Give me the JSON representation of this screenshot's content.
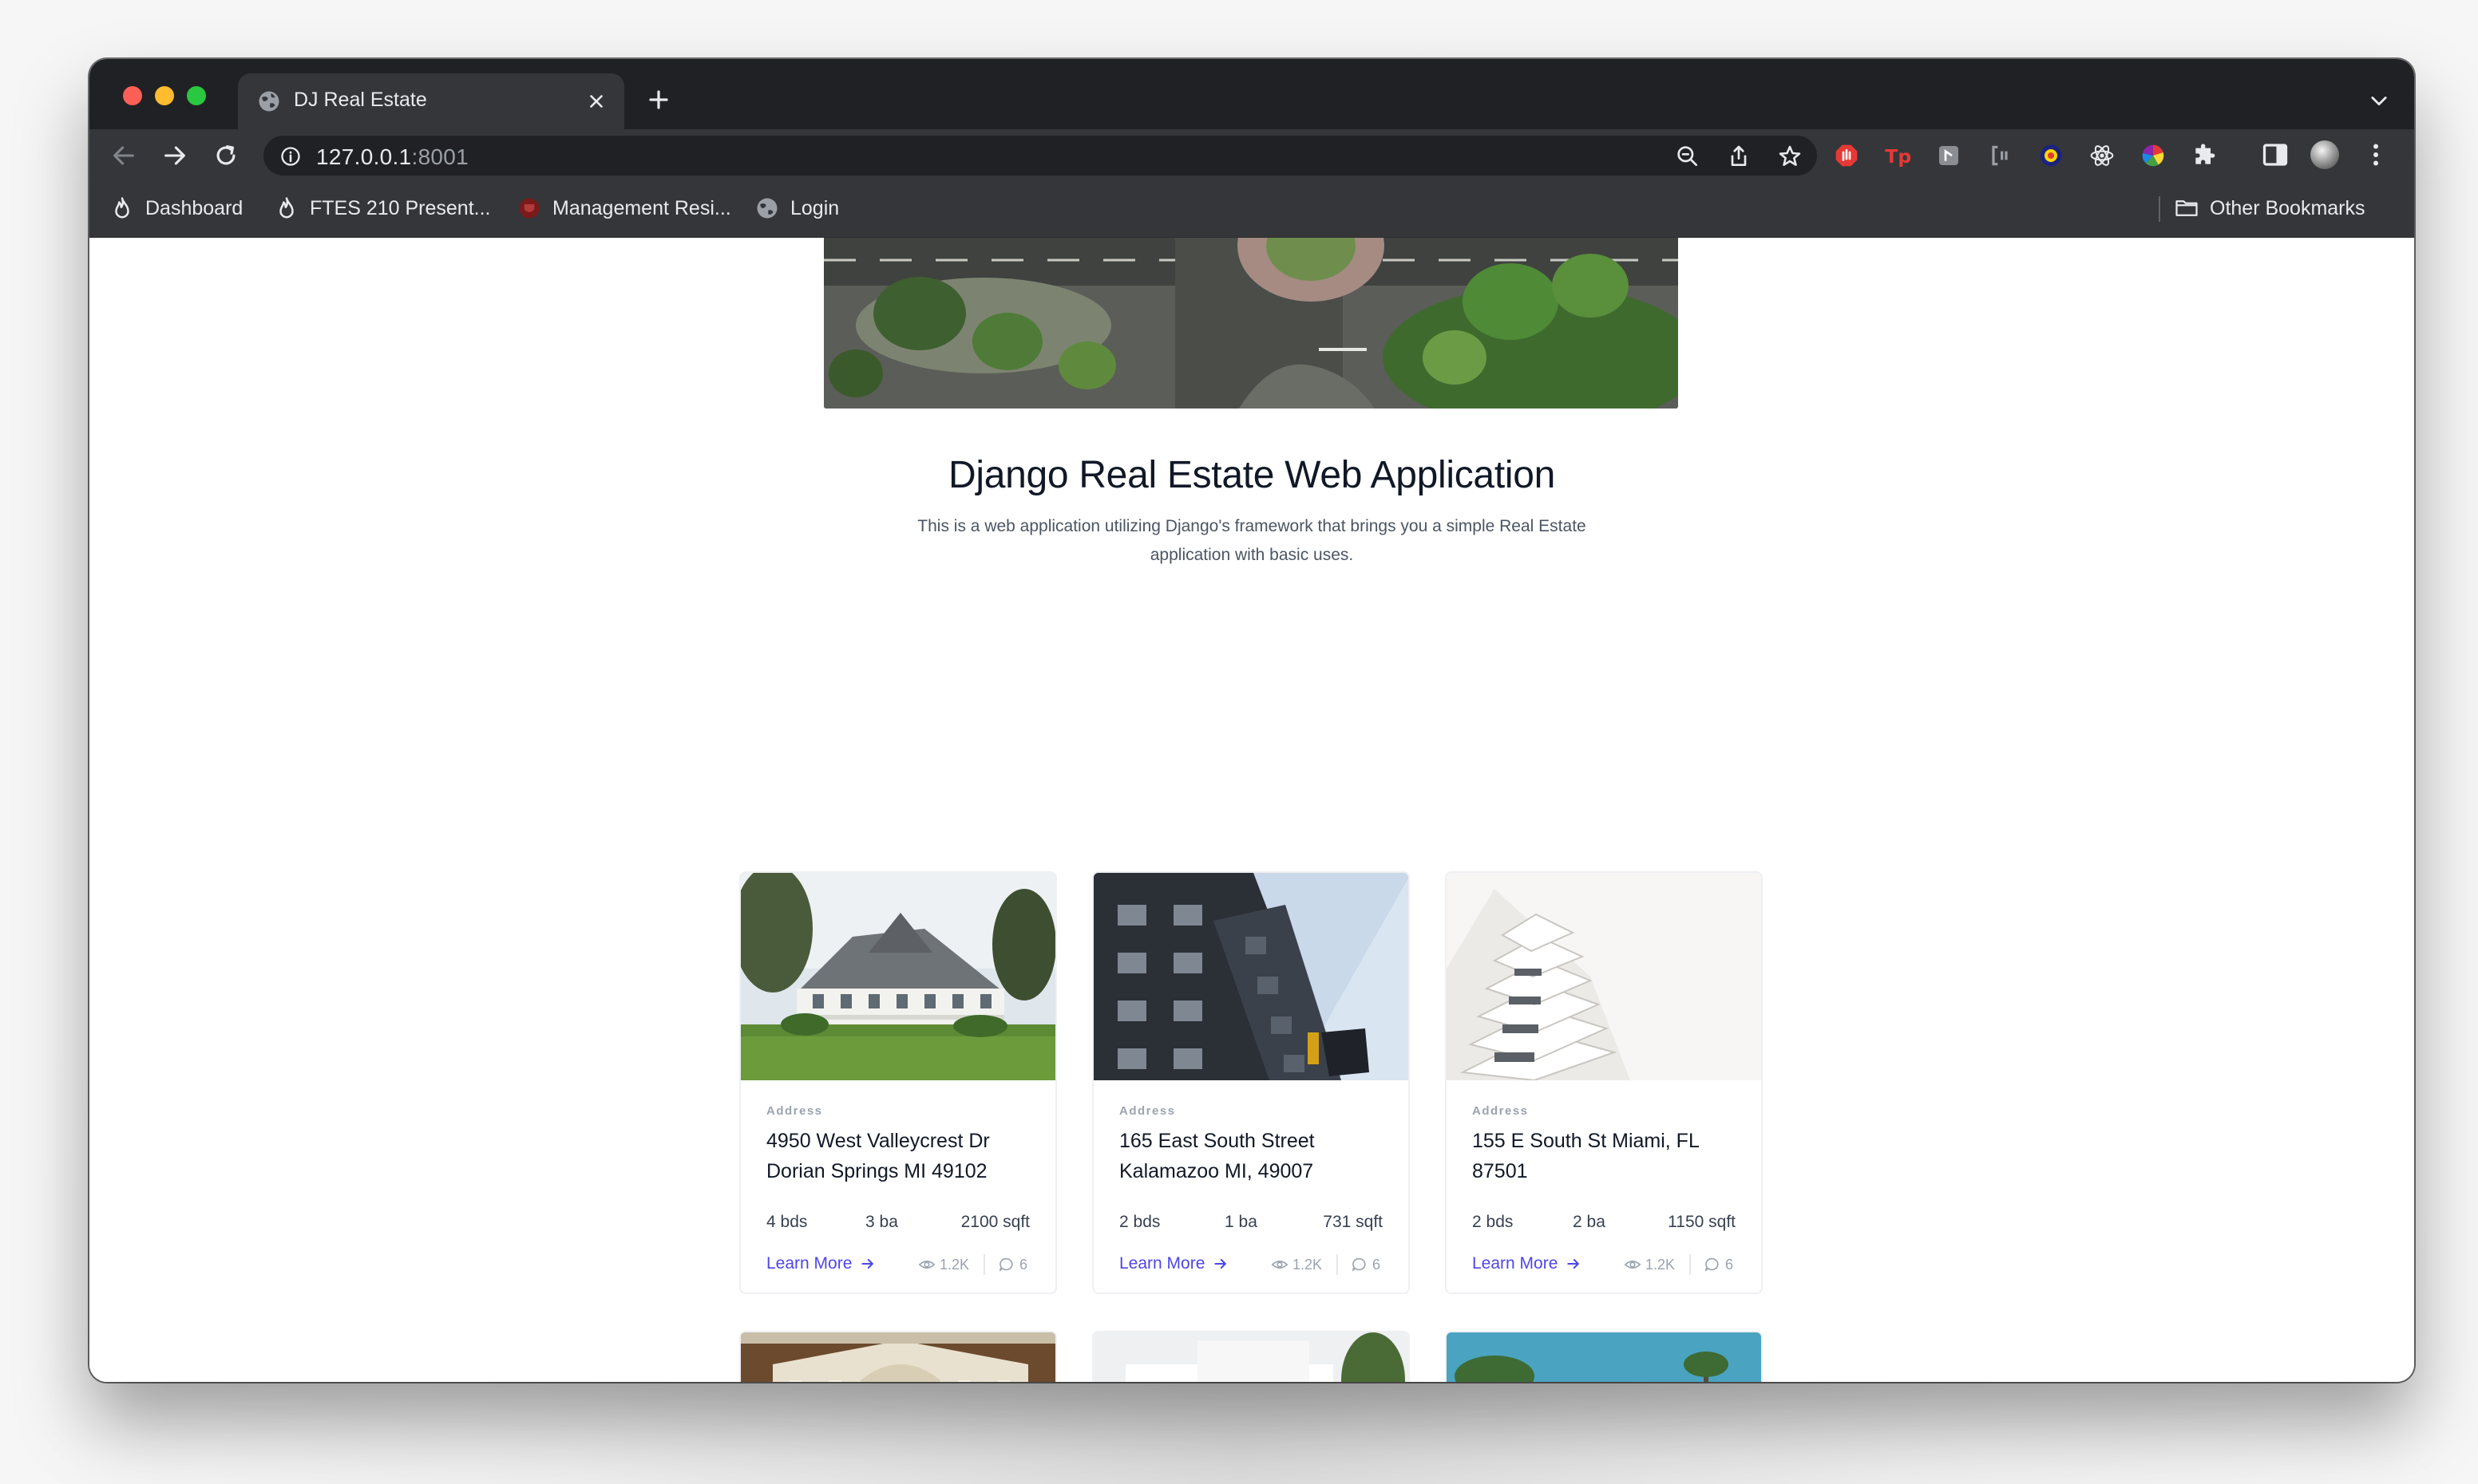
{
  "browser": {
    "tab_title": "DJ Real Estate",
    "url_host": "127.0.0.1",
    "url_port": ":8001",
    "bookmarks": [
      {
        "label": "Dashboard",
        "icon": "flame-icon"
      },
      {
        "label": "FTES 210 Present...",
        "icon": "flame-icon"
      },
      {
        "label": "Management Resi...",
        "icon": "crest-icon"
      },
      {
        "label": "Login",
        "icon": "globe-icon"
      }
    ],
    "other_bookmarks": "Other Bookmarks"
  },
  "hero": {
    "title": "Django Real Estate Web Application",
    "description": "This is a web application utilizing Django's framework that brings you a simple Real Estate application with basic uses."
  },
  "listings": [
    {
      "address_label": "Address",
      "address": "4950 West Valleycrest Dr Dorian Springs MI 49102",
      "beds": "4 bds",
      "baths": "3 ba",
      "sqft": "2100 sqft",
      "learn_more": "Learn More",
      "views": "1.2K",
      "comments": "6"
    },
    {
      "address_label": "Address",
      "address": "165 East South Street Kalamazoo MI, 49007",
      "beds": "2 bds",
      "baths": "1 ba",
      "sqft": "731 sqft",
      "learn_more": "Learn More",
      "views": "1.2K",
      "comments": "6"
    },
    {
      "address_label": "Address",
      "address": "155 E South St Miami, FL 87501",
      "beds": "2 bds",
      "baths": "2 ba",
      "sqft": "1150 sqft",
      "learn_more": "Learn More",
      "views": "1.2K",
      "comments": "6"
    }
  ],
  "colors": {
    "accent_link": "#4f46e5",
    "chrome_dark": "#202124",
    "chrome_toolbar": "#35363a"
  }
}
